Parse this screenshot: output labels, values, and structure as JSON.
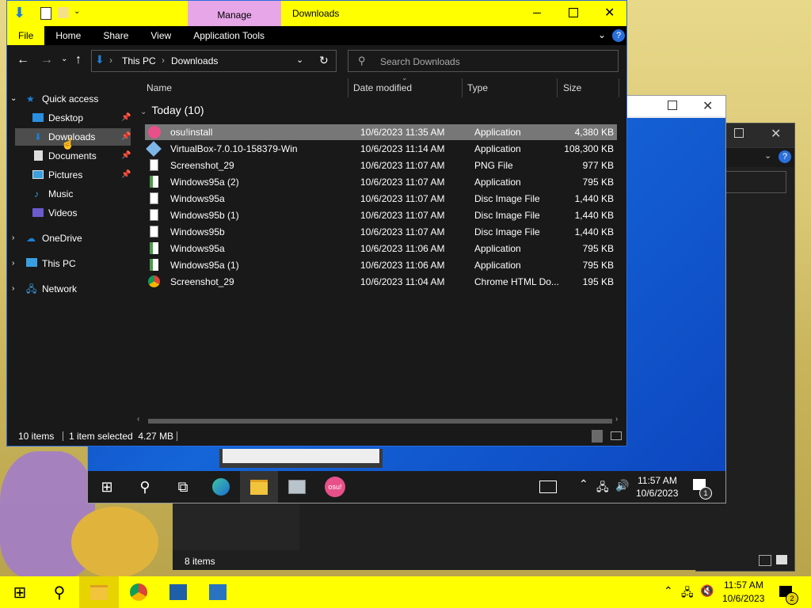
{
  "explorer": {
    "ribbon_context": "Manage",
    "window_title": "Downloads",
    "tabs": [
      "File",
      "Home",
      "Share",
      "View",
      "Application Tools"
    ],
    "address": {
      "root": "This PC",
      "current": "Downloads"
    },
    "search_placeholder": "Search Downloads",
    "nav": {
      "quick_access": "Quick access",
      "items": [
        "Desktop",
        "Downloads",
        "Documents",
        "Pictures",
        "Music",
        "Videos"
      ],
      "roots": [
        "OneDrive",
        "This PC",
        "Network"
      ]
    },
    "columns": [
      "Name",
      "Date modified",
      "Type",
      "Size"
    ],
    "group_label": "Today (10)",
    "files": [
      {
        "name": "osu!install",
        "date": "10/6/2023 11:35 AM",
        "type": "Application",
        "size": "4,380 KB"
      },
      {
        "name": "VirtualBox-7.0.10-158379-Win",
        "date": "10/6/2023 11:14 AM",
        "type": "Application",
        "size": "108,300 KB"
      },
      {
        "name": "Screenshot_29",
        "date": "10/6/2023 11:07 AM",
        "type": "PNG File",
        "size": "977 KB"
      },
      {
        "name": "Windows95a (2)",
        "date": "10/6/2023 11:07 AM",
        "type": "Application",
        "size": "795 KB"
      },
      {
        "name": "Windows95a",
        "date": "10/6/2023 11:07 AM",
        "type": "Disc Image File",
        "size": "1,440 KB"
      },
      {
        "name": "Windows95b (1)",
        "date": "10/6/2023 11:07 AM",
        "type": "Disc Image File",
        "size": "1,440 KB"
      },
      {
        "name": "Windows95b",
        "date": "10/6/2023 11:07 AM",
        "type": "Disc Image File",
        "size": "1,440 KB"
      },
      {
        "name": "Windows95a",
        "date": "10/6/2023 11:06 AM",
        "type": "Application",
        "size": "795 KB"
      },
      {
        "name": "Windows95a (1)",
        "date": "10/6/2023 11:06 AM",
        "type": "Application",
        "size": "795 KB"
      },
      {
        "name": "Screenshot_29",
        "date": "10/6/2023 11:04 AM",
        "type": "Chrome HTML Do...",
        "size": "195 KB"
      }
    ],
    "status": {
      "count": "10 items",
      "selected": "1 item selected  4.27 MB"
    }
  },
  "vm_taskbar": {
    "time": "11:57 AM",
    "date": "10/6/2023",
    "badge": "1",
    "app_label": "osu!"
  },
  "back_window": {
    "status": "8 items"
  },
  "taskbar": {
    "time": "11:57 AM",
    "date": "10/6/2023",
    "badge": "2"
  },
  "colors": {
    "accent": "#ffff00",
    "selection": "#777777",
    "vm_blue": "#1565d8"
  }
}
